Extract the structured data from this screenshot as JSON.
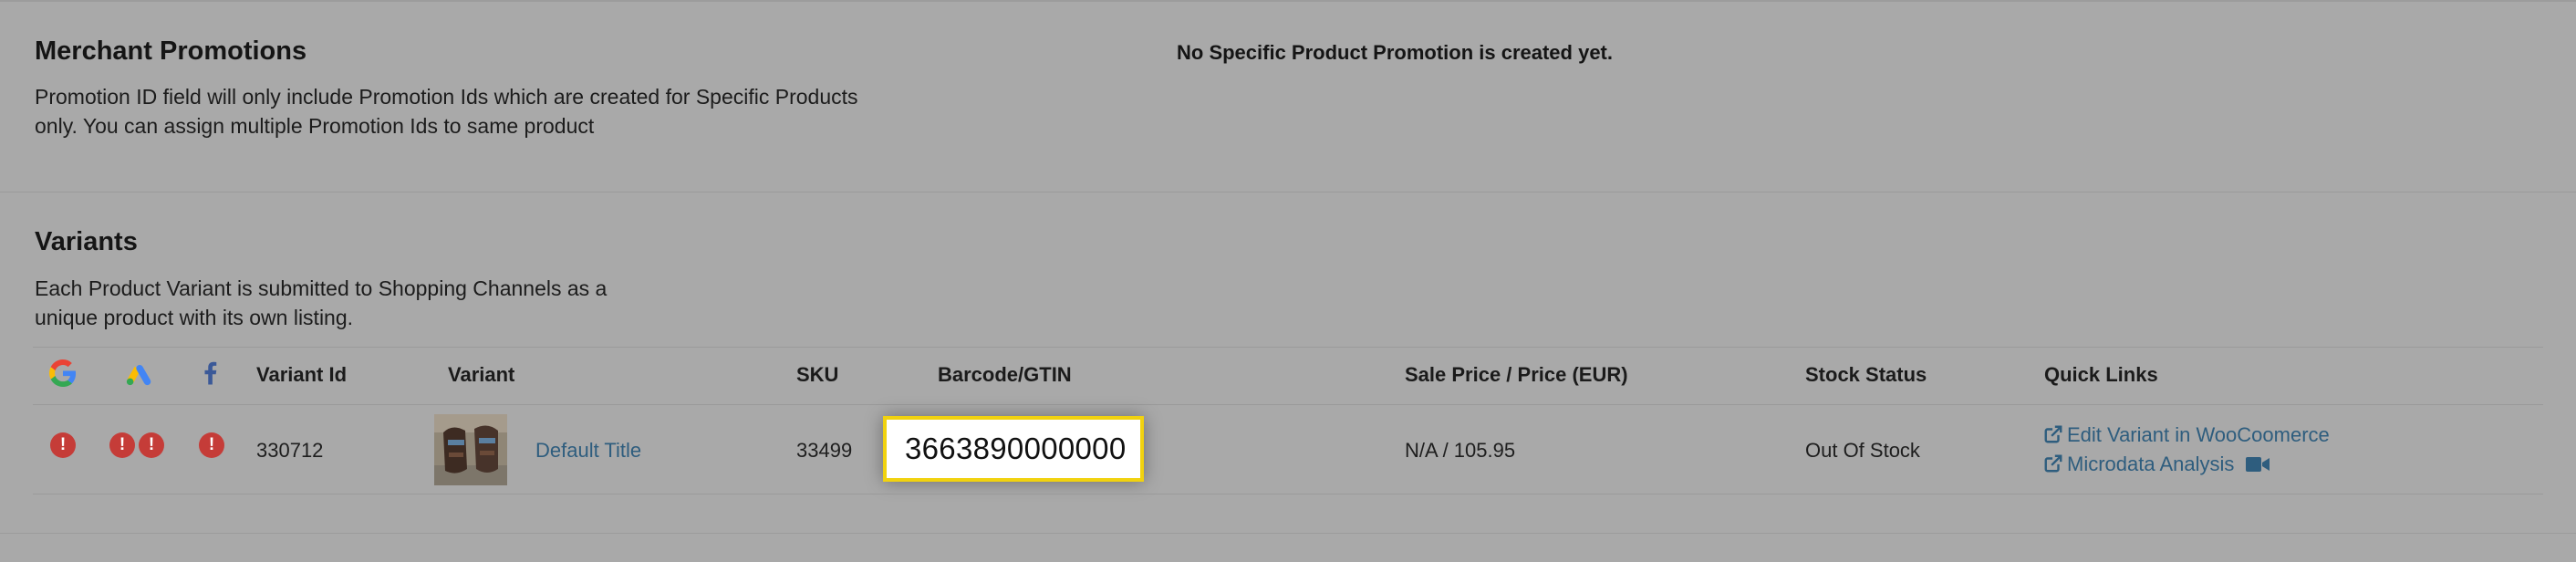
{
  "promotions": {
    "title": "Merchant Promotions",
    "desc_line1": "Promotion ID field will only include Promotion Ids which are created for Specific Products",
    "desc_line2": "only. You can assign multiple Promotion Ids to same product",
    "empty_message": "No Specific Product Promotion is created yet."
  },
  "variants": {
    "title": "Variants",
    "desc_line1": "Each Product Variant is submitted to Shopping Channels as a",
    "desc_line2": "unique product with its own listing.",
    "header_icons": [
      "google-icon",
      "google-ads-icon",
      "facebook-icon"
    ],
    "columns": {
      "variant_id": "Variant Id",
      "variant": "Variant",
      "sku": "SKU",
      "barcode": "Barcode/GTIN",
      "price": "Sale Price / Price (EUR)",
      "stock": "Stock Status",
      "links": "Quick Links"
    },
    "rows": [
      {
        "error_badge": "!",
        "variant_id": "330712",
        "variant_name": "Default Title",
        "sku": "33499",
        "barcode": "3663890000000",
        "price": "N/A / 105.95",
        "stock": "Out Of Stock",
        "edit_link": "Edit Variant in WooCoomerce",
        "microdata_link": "Microdata Analysis"
      }
    ]
  },
  "colors": {
    "background": "#a9a9a9",
    "error_badge": "#c53c38",
    "link": "#2e5d7e",
    "highlight_border": "#f1d20f",
    "google_blue": "#4285f4",
    "facebook_blue": "#3b5998"
  }
}
